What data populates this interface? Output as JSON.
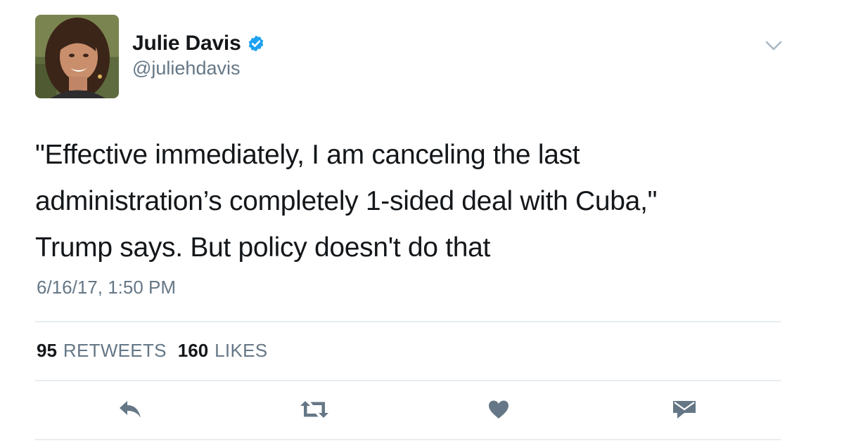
{
  "author": {
    "display_name": "Julie Davis",
    "handle": "@juliehdavis",
    "verified": true
  },
  "tweet": {
    "text_lines": [
      "\"Effective immediately, I am canceling the last",
      "administration’s completely 1-sided deal with Cuba,\"",
      "Trump says. But policy doesn't do that"
    ],
    "timestamp": "6/16/17, 1:50 PM"
  },
  "stats": {
    "retweets_count": "95",
    "retweets_label": "RETWEETS",
    "likes_count": "160",
    "likes_label": "LIKES"
  },
  "actions": [
    "reply-icon",
    "retweet-icon",
    "like-icon",
    "direct-message-icon"
  ],
  "colors": {
    "text": "#14171a",
    "secondary_text": "#657786",
    "verified_blue": "#1da1f2",
    "icon_gray": "#657786",
    "divider": "#e6ecf0"
  }
}
